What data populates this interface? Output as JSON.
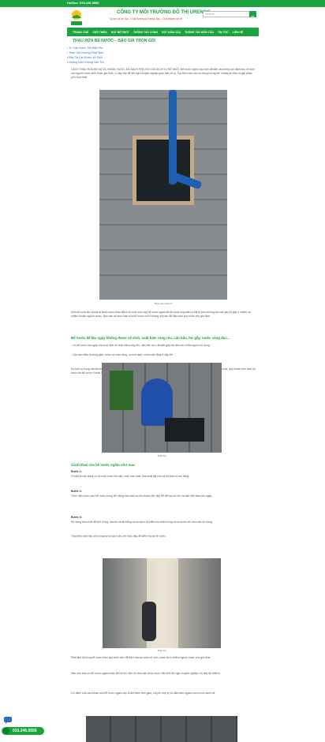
{
  "topbar": {
    "hotline": "Hotline: 033.246.5555"
  },
  "header": {
    "company": "CÔNG TY MÔI TRƯỜNG ĐÔ THỊ URENCO",
    "slogan": "Uy tín là tối đa - Chất lượng là hàng đầu - Giá thành rất rẻ",
    "search_placeholder": "Search..."
  },
  "nav": [
    "TRANG CHỦ",
    "GIỚI THIỆU",
    "HÚT BỂ PHỐT",
    "THÔNG TẮC CỐNG",
    "HÚT HẦM CẦU",
    "THÔNG TẮC BỒN CẦU",
    "TIN TỨC",
    "LIÊN HỆ"
  ],
  "page_title": "THAU RỬA BỂ NƯỚC – BÁO GIÁ TRỌN GÓI",
  "toc": [
    "Tư Vấn Được Sở Miễn Phí",
    "Thao Tác Đường Phát Sinh",
    "Đặc Tả Các Bước Vệ Sinh",
    "Những Dịch Không Cần Trả"
  ],
  "intro": "CÁCH THAU RỬA BỂ NƯỚC NGẦM, NƯỚC ĐÁ SẠCH PHN VỚI GIÁ DỊCH VỤ RẺ NHẤT. Bể nước ngầm của bạn đã bẩn và không còn đảm bảo vệ sinh cho nguồn nước sinh hoạt, gia đình, vì vậy hãy để đội ngũ chuyên nghiệp giúp bạn xử lý. Tuy theo nhu cầu và dung lượng bể, chúng tôi đưa ra giải pháp phù hợp nhất.",
  "caption1": "Thau bể nước ốn",
  "para1": "Một bể nước ăn và thế là bệnh nước thau đặt ở thì mới nhờ hay bể nước ngầm bể đủ dưới lòng đất có thể bị ảnh hưởng bởi các yếu tố gây ô nhiễm và nhiễm khuẩn nguồn nước. Bạn cần vệ sinh thau rửa bể nước mỗi 6 tháng một lần để đảm bảo sức khỏe cho gia đình.",
  "h2": "Bể nước để lâu ngày không được vệ sinh, xuất hiện rong rêu, cặn bẩn, hư gẫy, nước vàng đục...",
  "para2a": "- Có bể nước lâu ngày chưa vệ sinh sẽ xuất hiện rong rêu, cặn bẩn và vi khuẩn gây hại đến sức khỏe người sử dụng.",
  "para2b": "- Các dấu hiệu thường gặp: nước có màu vàng, có mùi tanh, nhiều cặn lắng ở đáy bể.",
  "para3": "Do tính tự trọng mới trường thiêu sinh vòng, để làm cho bể nước ngầm trở nên sạch sẽ, đảm bảo chất lượng nguồn nước sinh hoạt, quý khách nên định kỳ thau rửa bể nước ít nhất 2 lần mỗi năm.",
  "caption2": "Thau bể",
  "h2b": "Cách thau rửa bể nước ngầm như sau:",
  "step1_title": "Bước 1:",
  "step1": "Chuẩn bị các dụng cụ vệ sinh: bơm hút cặn, chổi, bàn chải, hóa chất tẩy rửa và đồ bảo hộ lao động.",
  "step2_title": "Bước 2:",
  "step2": "Thực hiện bơm cạn hết nước trong bể, dùng bàn chải cọ rửa thành bể, đáy bể để loại bỏ rêu và cặn bẩn bám lâu ngày.",
  "step3_title": "Bước 3:",
  "step3": "Sử dụng hóa chất để khử trùng, sau đó xả lại bằng nước sạch và kiểm tra chất lượng nước trước khi đưa vào sử dụng.",
  "para4": "Tiếp theo bạn hãy xả lượng nước sạch cho tới mức đầy để kiểm tra lại bể nước.",
  "caption3": "Thau bể",
  "para5": "Phải làm kỹ từng bể nước theo quy trình trên để đảm bảo an toàn vệ sinh, tránh tái ô nhiễm nguồn nước cho gia đình.",
  "para6": "Nếu như bạn có bể nước ngầm hoặc bể lớn thì việc vệ sinh nên được thực hiện bởi đội ngũ chuyên nghiệp với đầy đủ thiết bị.",
  "para7": "Ưu điểm của cách thau rửa bể nước ngầm này là tiết kiệm thời gian, chi phí hợp lý và đảm bảo nguồn nước luôn sạch sẽ.",
  "phone": "033.246.5555",
  "colors": {
    "brand_green": "#1aa33f",
    "link_blue": "#2a6ec8"
  }
}
